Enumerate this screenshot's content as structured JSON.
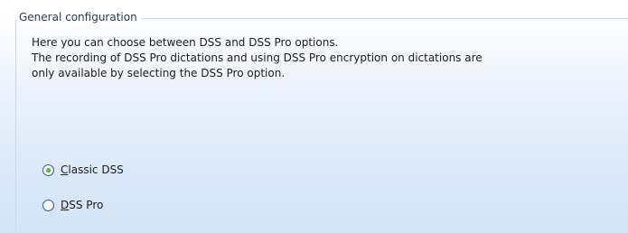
{
  "group": {
    "title": "General configuration",
    "description": [
      "Here you can choose between DSS and DSS Pro options.",
      "The recording of DSS Pro dictations and using DSS Pro encryption on dictations are",
      "only available by selecting the DSS Pro option."
    ]
  },
  "options": [
    {
      "mnemonic": "C",
      "label_rest": "lassic DSS",
      "label": "Classic DSS",
      "selected": true
    },
    {
      "mnemonic": "D",
      "label_rest": "SS Pro",
      "label": "DSS Pro",
      "selected": false
    }
  ],
  "colors": {
    "accent": "#3f9f33",
    "border": "#d2d8e0",
    "radio_border": "#2d5f94",
    "gradient_bottom": "#d4e4f7"
  },
  "icons": {
    "radio_selected": "radio-selected-icon",
    "radio_unselected": "radio-unselected-icon"
  }
}
